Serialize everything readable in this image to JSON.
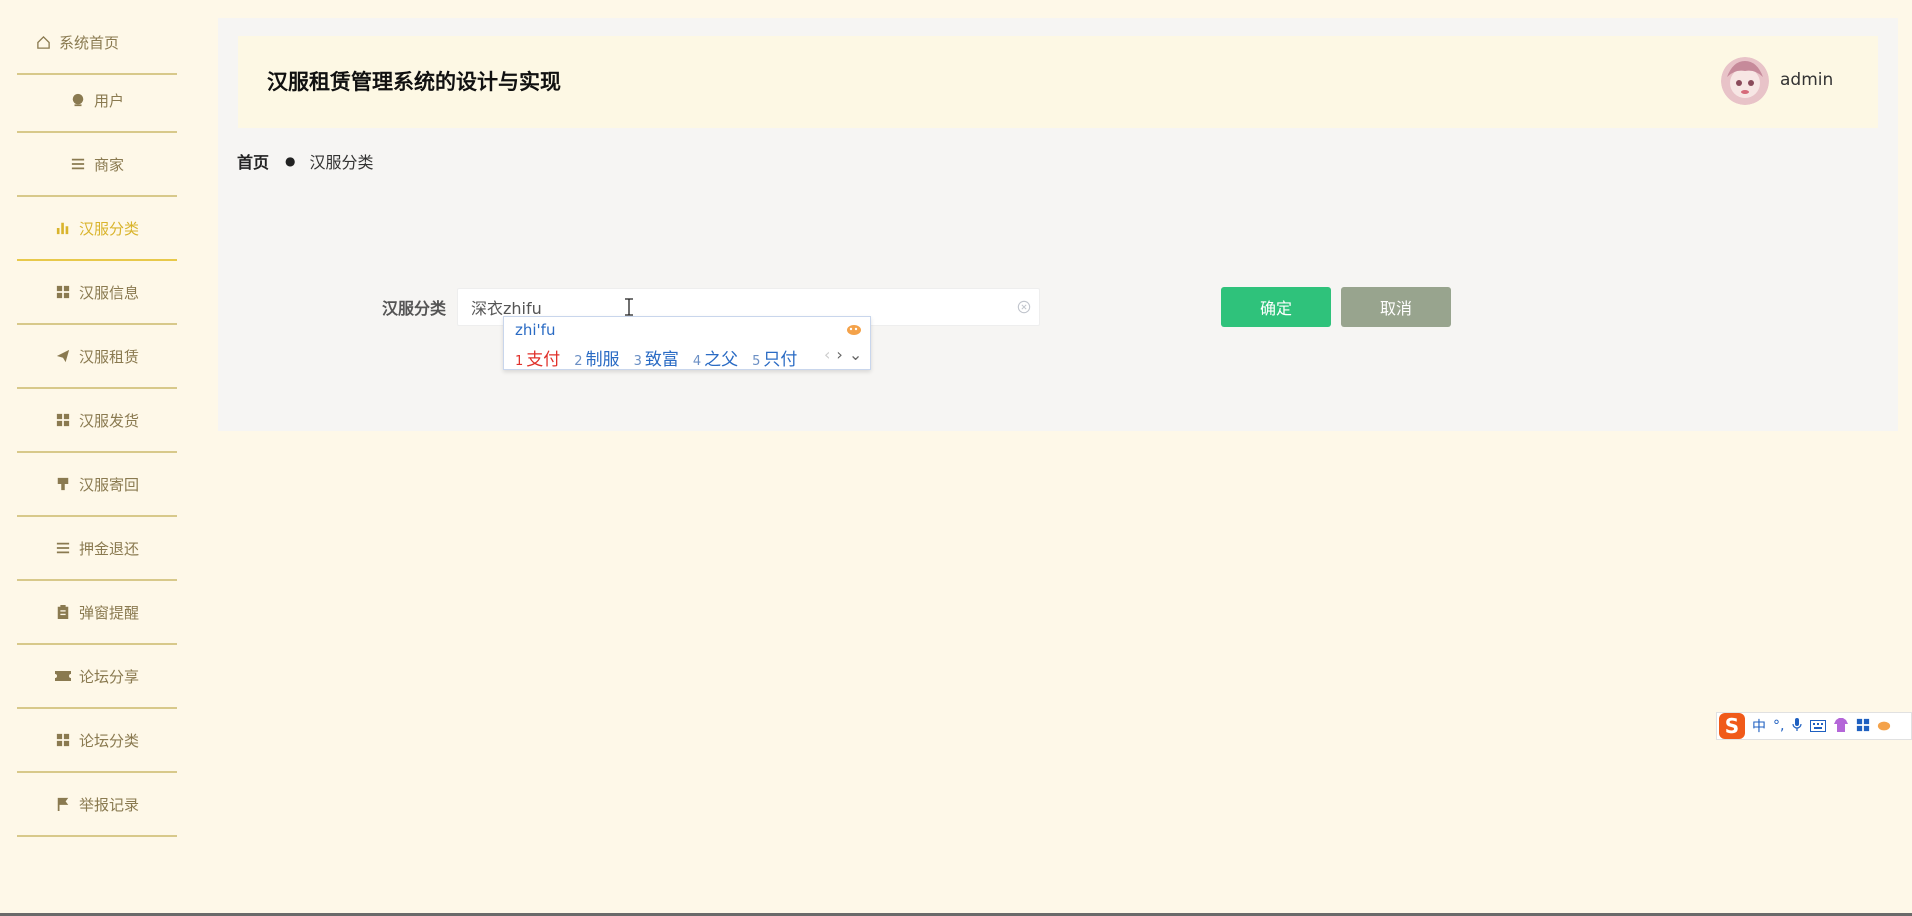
{
  "sidebar": {
    "items": [
      {
        "label": "系统首页",
        "icon": "home-icon"
      },
      {
        "label": "用户",
        "icon": "user-icon"
      },
      {
        "label": "商家",
        "icon": "list-icon"
      },
      {
        "label": "汉服分类",
        "icon": "bar-chart-icon",
        "active": true
      },
      {
        "label": "汉服信息",
        "icon": "grid-icon"
      },
      {
        "label": "汉服租赁",
        "icon": "paper-plane-icon"
      },
      {
        "label": "汉服发货",
        "icon": "grid-icon"
      },
      {
        "label": "汉服寄回",
        "icon": "brush-icon"
      },
      {
        "label": "押金退还",
        "icon": "list-icon"
      },
      {
        "label": "弹窗提醒",
        "icon": "clipboard-icon"
      },
      {
        "label": "论坛分享",
        "icon": "ticket-icon"
      },
      {
        "label": "论坛分类",
        "icon": "grid-icon"
      },
      {
        "label": "举报记录",
        "icon": "flag-icon"
      }
    ]
  },
  "header": {
    "title": "汉服租赁管理系统的设计与实现",
    "username": "admin"
  },
  "breadcrumb": {
    "home": "首页",
    "separator": "●",
    "current": "汉服分类"
  },
  "form": {
    "label": "汉服分类",
    "value": "深衣zhifu",
    "confirm_label": "确定",
    "cancel_label": "取消"
  },
  "ime": {
    "pinyin": "zhi'fu",
    "candidates": [
      {
        "n": "1",
        "text": "支付"
      },
      {
        "n": "2",
        "text": "制服"
      },
      {
        "n": "3",
        "text": "致富"
      },
      {
        "n": "4",
        "text": "之父"
      },
      {
        "n": "5",
        "text": "只付"
      }
    ],
    "prev": "‹",
    "next": "›",
    "expand": "⌄"
  },
  "imebar": {
    "logo": "S",
    "mode": "中",
    "punct": "°,"
  },
  "colors": {
    "background": "#fef8e8",
    "sidebar_active": "#d9b42c",
    "confirm": "#2fc27b",
    "cancel": "#98a48e"
  }
}
